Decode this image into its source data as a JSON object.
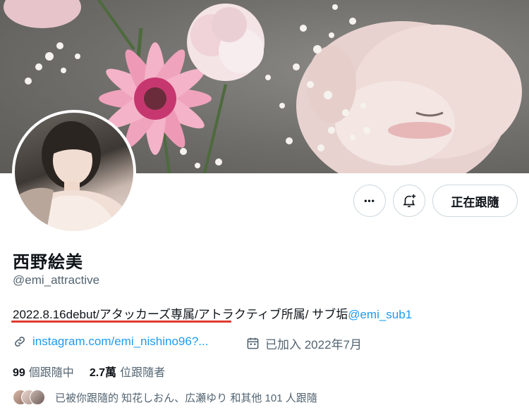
{
  "profile": {
    "name": "西野絵美",
    "handle": "@emi_attractive",
    "bio_text": "2022.8.16debut/アタッカーズ専属/アトラクティブ所属/ サブ垢",
    "bio_mention": "@emi_sub1",
    "link_text": "instagram.com/emi_nishino96?...",
    "joined_text": "已加入 2022年7月"
  },
  "actions": {
    "more_label": "•••",
    "following_label": "正在跟隨"
  },
  "stats": {
    "following_count": "99",
    "following_label": "個跟隨中",
    "followers_count": "2.7萬",
    "followers_label": "位跟隨者"
  },
  "followed_by": {
    "text": "已被你跟隨的 知花しおん、広瀬ゆり 和其他 101 人跟隨"
  },
  "colors": {
    "accent": "#1d9bf0",
    "text_primary": "#0f1419",
    "text_secondary": "#536471",
    "border": "#cfd9de",
    "annotation_underline": "#e03a2f"
  },
  "icons": {
    "link": "link-icon",
    "calendar": "calendar-icon",
    "notify": "bell-plus-icon",
    "more": "more-icon"
  }
}
